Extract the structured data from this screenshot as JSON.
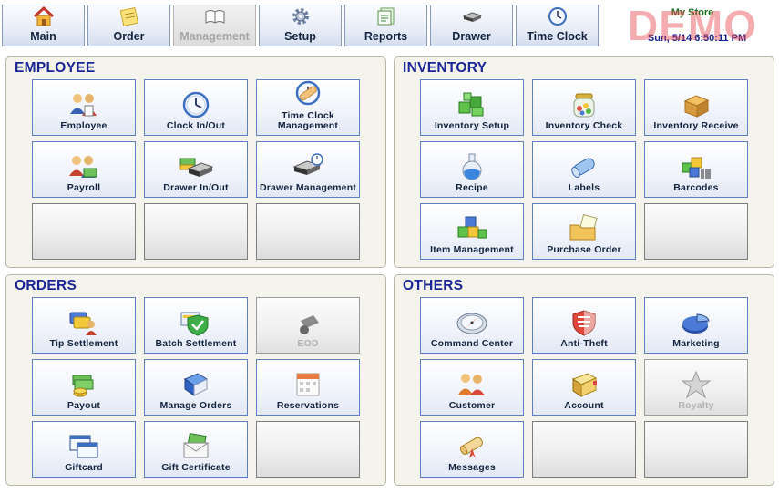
{
  "toolbar": {
    "tabs": [
      {
        "label": "Main",
        "icon": "home-icon"
      },
      {
        "label": "Order",
        "icon": "notepad-icon"
      },
      {
        "label": "Management",
        "icon": "book-icon",
        "state": "active"
      },
      {
        "label": "Setup",
        "icon": "gear-icon"
      },
      {
        "label": "Reports",
        "icon": "report-icon"
      },
      {
        "label": "Drawer",
        "icon": "drawer-icon"
      },
      {
        "label": "Time Clock",
        "icon": "clock-icon"
      }
    ],
    "store_name": "My Store",
    "datetime": "Sun, 5/14 6:50:11 PM",
    "watermark": "DEMO"
  },
  "sections": {
    "employee": {
      "title": "EMPLOYEE",
      "tiles": [
        "Employee",
        "Clock In/Out",
        "Time Clock Management",
        "Payroll",
        "Drawer In/Out",
        "Drawer Management"
      ]
    },
    "inventory": {
      "title": "INVENTORY",
      "tiles": [
        "Inventory Setup",
        "Inventory Check",
        "Inventory Receive",
        "Recipe",
        "Labels",
        "Barcodes",
        "Item Management",
        "Purchase Order"
      ]
    },
    "orders": {
      "title": "ORDERS",
      "tiles": [
        "Tip Settlement",
        "Batch Settlement",
        "EOD",
        "Payout",
        "Manage Orders",
        "Reservations",
        "Giftcard",
        "Gift Certificate"
      ]
    },
    "others": {
      "title": "OTHERS",
      "tiles": [
        "Command Center",
        "Anti-Theft",
        "Marketing",
        "Customer",
        "Account",
        "Royalty",
        "Messages"
      ]
    }
  },
  "colors": {
    "section_title": "#1a2596",
    "tile_border": "#5f7fbf",
    "panel_bg": "#f4f3ec",
    "store_name": "#1b6e1b",
    "datetime": "#16208a",
    "watermark": "#e84650"
  }
}
